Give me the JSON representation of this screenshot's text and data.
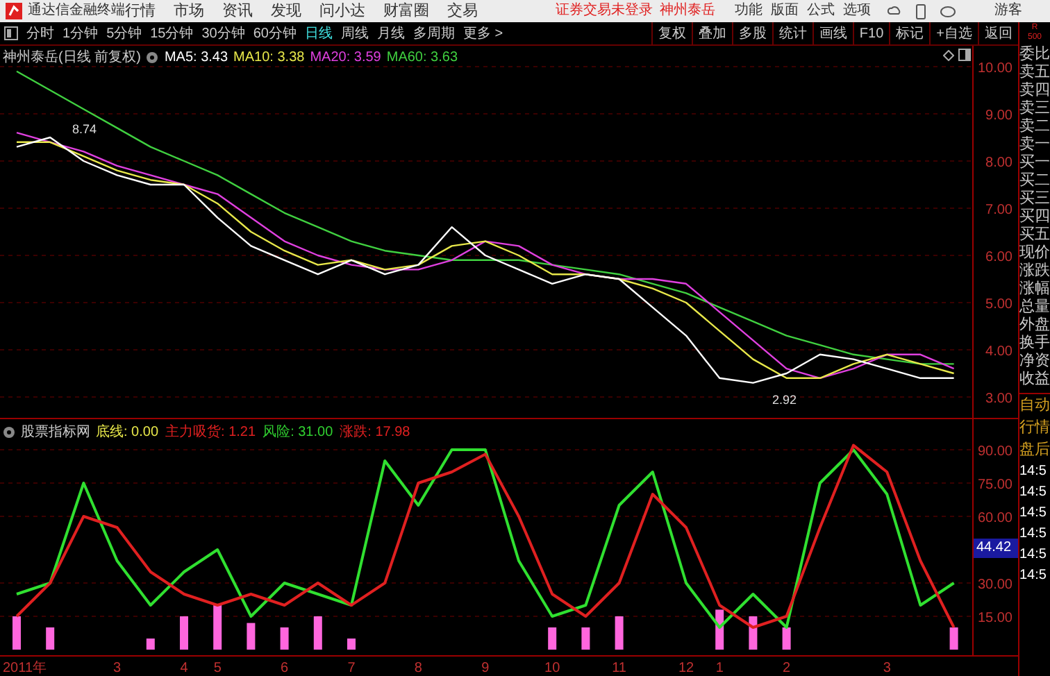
{
  "app": {
    "title": "通达信金融终端",
    "menus": [
      "行情",
      "市场",
      "资讯",
      "发现",
      "问小达",
      "财富圈",
      "交易"
    ],
    "login_notice": "证券交易未登录",
    "stock_link": "神州泰岳",
    "right_menus": [
      "功能",
      "版面",
      "公式",
      "选项"
    ],
    "user": "游客"
  },
  "periods": [
    {
      "label": "分时",
      "selected": false
    },
    {
      "label": "1分钟",
      "selected": false
    },
    {
      "label": "5分钟",
      "selected": false
    },
    {
      "label": "15分钟",
      "selected": false
    },
    {
      "label": "30分钟",
      "selected": false
    },
    {
      "label": "60分钟",
      "selected": false
    },
    {
      "label": "日线",
      "selected": true
    },
    {
      "label": "周线",
      "selected": false
    },
    {
      "label": "月线",
      "selected": false
    },
    {
      "label": "多周期",
      "selected": false
    },
    {
      "label": "更多 >",
      "selected": false
    }
  ],
  "tools": [
    "复权",
    "叠加",
    "多股",
    "统计",
    "画线",
    "F10",
    "标记",
    "+自选",
    "返回"
  ],
  "corner": [
    "R",
    "500"
  ],
  "price_panel": {
    "title": "神州泰岳(日线 前复权)",
    "legend": [
      {
        "label": "MA5: 3.43",
        "color": "#ffffff"
      },
      {
        "label": "MA10: 3.38",
        "color": "#e8e84a"
      },
      {
        "label": "MA20: 3.59",
        "color": "#e040e0"
      },
      {
        "label": "MA60: 3.63",
        "color": "#40d040"
      }
    ],
    "chart_data": {
      "type": "line",
      "grid": true,
      "ylim": [
        2.56,
        10.44
      ],
      "yticks": [
        {
          "value": 10,
          "label": "10.00"
        },
        {
          "value": 9,
          "label": "9.00"
        },
        {
          "value": 8,
          "label": "8.00"
        },
        {
          "value": 7,
          "label": "7.00"
        },
        {
          "value": 6,
          "label": "6.00"
        },
        {
          "value": 5,
          "label": "5.00"
        },
        {
          "value": 4,
          "label": "4.00"
        },
        {
          "value": 3,
          "label": "3.00"
        }
      ],
      "series": [
        {
          "color": "#40d040",
          "values": [
            9.9,
            9.5,
            9.1,
            8.7,
            8.3,
            8.0,
            7.7,
            7.3,
            6.9,
            6.6,
            6.3,
            6.1,
            6.0,
            5.9,
            5.9,
            5.9,
            5.8,
            5.7,
            5.6,
            5.4,
            5.2,
            4.9,
            4.6,
            4.3,
            4.1,
            3.9,
            3.8,
            3.7,
            3.7
          ]
        },
        {
          "color": "#e040e0",
          "values": [
            8.6,
            8.4,
            8.2,
            7.9,
            7.7,
            7.5,
            7.3,
            6.8,
            6.3,
            6.0,
            5.8,
            5.7,
            5.7,
            5.9,
            6.3,
            6.2,
            5.8,
            5.6,
            5.5,
            5.5,
            5.4,
            4.8,
            4.2,
            3.6,
            3.4,
            3.6,
            3.9,
            3.9,
            3.6
          ]
        },
        {
          "color": "#e8e84a",
          "values": [
            8.4,
            8.4,
            8.1,
            7.8,
            7.6,
            7.5,
            7.1,
            6.5,
            6.1,
            5.8,
            5.9,
            5.7,
            5.8,
            6.2,
            6.3,
            6.0,
            5.6,
            5.6,
            5.5,
            5.3,
            5.0,
            4.4,
            3.8,
            3.4,
            3.4,
            3.7,
            3.9,
            3.7,
            3.5
          ]
        },
        {
          "color": "#ffffff",
          "values": [
            8.3,
            8.5,
            8.0,
            7.7,
            7.5,
            7.5,
            6.8,
            6.2,
            5.9,
            5.6,
            5.9,
            5.6,
            5.8,
            6.6,
            6.0,
            5.7,
            5.4,
            5.6,
            5.5,
            4.9,
            4.3,
            3.4,
            3.3,
            3.5,
            3.9,
            3.8,
            3.6,
            3.4,
            3.4
          ]
        }
      ],
      "annotations": [
        "8.74",
        "2.92"
      ]
    }
  },
  "indicator_panel": {
    "title": "股票指标网",
    "legend": [
      {
        "label": "底线: 0.00",
        "color": "#e8e84a"
      },
      {
        "label": "主力吸货: 1.21",
        "color": "#e02020"
      },
      {
        "label": "风险: 31.00",
        "color": "#30d030"
      },
      {
        "label": "涨跌: 17.98",
        "color": "#e02020"
      }
    ],
    "current_value": "44.42",
    "chart_data": {
      "type": "line",
      "grid": true,
      "categories": [
        "2011年",
        null,
        null,
        "3",
        null,
        "4",
        "5",
        null,
        "6",
        null,
        "7",
        null,
        "8",
        null,
        "9",
        null,
        "10",
        null,
        "11",
        null,
        "12",
        "1",
        null,
        "2",
        null,
        null,
        "3",
        null,
        null
      ],
      "ylim": [
        -2.5,
        103.75
      ],
      "yticks": [
        {
          "value": 90,
          "label": "90.00"
        },
        {
          "value": 75,
          "label": "75.00"
        },
        {
          "value": 60,
          "label": "60.00"
        },
        {
          "value": 30,
          "label": "30.00"
        },
        {
          "value": 15,
          "label": "15.00"
        }
      ],
      "series": [
        {
          "color": "#ff66dd",
          "type": "bar",
          "values": [
            15,
            10,
            0,
            0,
            5,
            15,
            20,
            12,
            10,
            15,
            5,
            0,
            0,
            0,
            0,
            0,
            10,
            10,
            15,
            0,
            0,
            18,
            15,
            10,
            0,
            0,
            0,
            0,
            10
          ]
        },
        {
          "color": "#30e030",
          "type": "line",
          "values": [
            25,
            30,
            75,
            40,
            20,
            35,
            45,
            15,
            30,
            25,
            20,
            85,
            65,
            90,
            90,
            40,
            15,
            20,
            65,
            80,
            30,
            10,
            25,
            10,
            75,
            90,
            70,
            20,
            30
          ]
        },
        {
          "color": "#e02020",
          "type": "line",
          "values": [
            15,
            30,
            60,
            55,
            35,
            25,
            20,
            25,
            20,
            30,
            20,
            30,
            75,
            80,
            88,
            60,
            25,
            15,
            30,
            70,
            55,
            20,
            10,
            15,
            55,
            92,
            80,
            40,
            10
          ]
        }
      ]
    }
  },
  "quote_panel": {
    "labels": [
      "委比",
      "卖五",
      "卖四",
      "卖三",
      "卖二",
      "卖一",
      "买一",
      "买二",
      "买三",
      "买四",
      "买五",
      "现价",
      "涨跌",
      "涨幅",
      "总量",
      "外盘",
      "换手",
      "净资",
      "收益"
    ],
    "tabs": [
      "自动",
      "行情",
      "盘后"
    ],
    "times": [
      "14:5",
      "14:5",
      "14:5",
      "14:5",
      "14:5",
      "14:5"
    ]
  }
}
